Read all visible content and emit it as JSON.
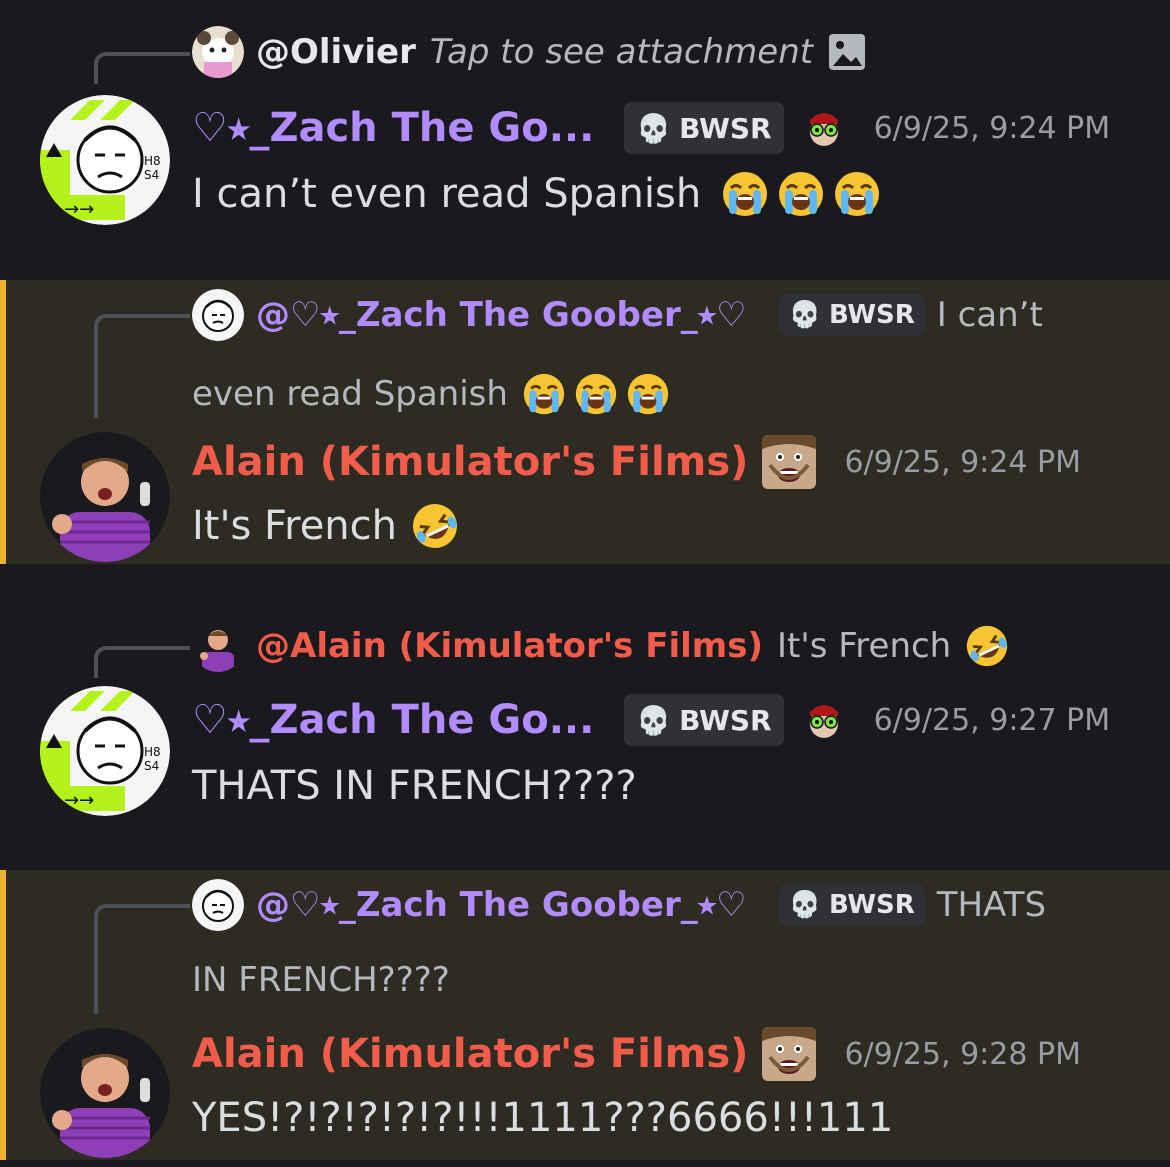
{
  "messages": [
    {
      "reply": {
        "name": "@Olivier",
        "text": "Tap to see attachment"
      },
      "author": "♡⭒_Zach The Go...",
      "tag": "BWSR",
      "timestamp": "6/9/25, 9:24 PM",
      "content": "I can’t even read Spanish",
      "emoji": "loudly-crying-face ×3"
    },
    {
      "reply": {
        "name": "@♡⭒_Zach The Goober_⭒♡",
        "tag": "BWSR",
        "text_line1": "I can’t",
        "text_line2": "even read Spanish"
      },
      "author": "Alain (Kimulator's Films)",
      "timestamp": "6/9/25, 9:24 PM",
      "content": "It's French",
      "emoji": "rolling-on-floor-laughing"
    },
    {
      "reply": {
        "name": "@Alain (Kimulator's Films)",
        "text": "It's French"
      },
      "author": "♡⭒_Zach The Go...",
      "tag": "BWSR",
      "timestamp": "6/9/25, 9:27 PM",
      "content": "THATS IN FRENCH????"
    },
    {
      "reply": {
        "name": "@♡⭒_Zach The Goober_⭒♡",
        "tag": "BWSR",
        "text_line1": "THATS",
        "text_line2": "IN FRENCH????"
      },
      "author": "Alain (Kimulator's Films)",
      "timestamp": "6/9/25, 9:28 PM",
      "content": "YES!?!?!?!?!?!!!1111???6666!!!111"
    }
  ],
  "colors": {
    "zach": "#b28cff",
    "alain": "#f25c4a",
    "mention_bar": "#f0b232",
    "mention_bg": "#2e2b23",
    "bg": "#1a1a1e"
  }
}
